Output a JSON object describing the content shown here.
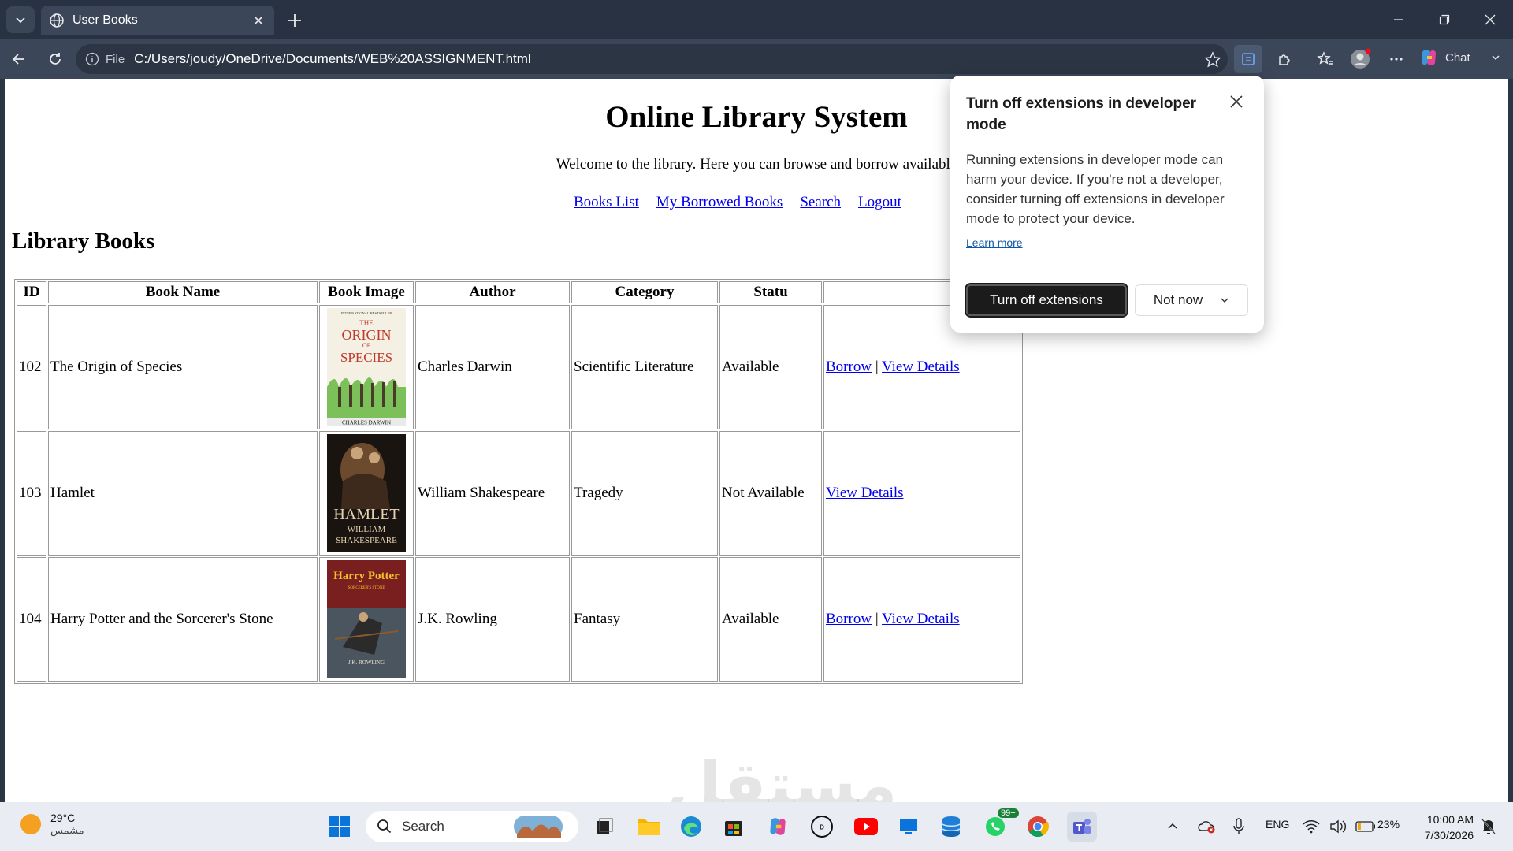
{
  "browser": {
    "tab_title": "User Books",
    "url_prefix": "File",
    "url": "C:/Users/joudy/OneDrive/Documents/WEB%20ASSIGNMENT.html",
    "chat_label": "Chat"
  },
  "page": {
    "heading": "Online Library System",
    "welcome": "Welcome to the library. Here you can browse and borrow available",
    "nav": [
      "Books List",
      "My Borrowed Books",
      "Search",
      "Logout"
    ],
    "section_title": "Library Books",
    "table": {
      "headers": [
        "ID",
        "Book Name",
        "Book Image",
        "Author",
        "Category",
        "Statu"
      ],
      "rows": [
        {
          "id": "102",
          "name": "The Origin of Species",
          "author": "Charles Darwin",
          "category": "Scientific Literature",
          "status": "Available",
          "borrow": "Borrow",
          "sep": "|",
          "details": "View Details",
          "cover": {
            "lines": [
              "THE",
              "ORIGIN",
              "OF",
              "SPECIES"
            ],
            "byline": "CHARLES DARWIN",
            "top": "INTERNATIONAL BESTSELLER"
          }
        },
        {
          "id": "103",
          "name": "Hamlet",
          "author": "William Shakespeare",
          "category": "Tragedy",
          "status": "Not Available",
          "details": "View Details",
          "cover": {
            "title": "HAMLET",
            "byline1": "WILLIAM",
            "byline2": "SHAKESPEARE"
          }
        },
        {
          "id": "104",
          "name": "Harry Potter and the Sorcerer's Stone",
          "author": "J.K. Rowling",
          "category": "Fantasy",
          "status": "Available",
          "borrow": "Borrow",
          "sep": "|",
          "details": "View Details",
          "cover": {
            "title": "Harry Potter",
            "subtitle": "SORCERER'S STONE",
            "byline": "J.K. ROWLING"
          }
        }
      ]
    },
    "watermark": "مستقل"
  },
  "popup": {
    "title": "Turn off extensions in developer mode",
    "body": "Running extensions in developer mode can harm your device. If you're not a developer, consider turning off extensions in developer mode to protect your device.",
    "learn_more": "Learn more",
    "primary": "Turn off extensions",
    "secondary": "Not now"
  },
  "taskbar": {
    "temperature": "29°C",
    "weather_desc": "مشمس",
    "search_placeholder": "Search",
    "whatsapp_badge": "99+",
    "language": "ENG",
    "battery": "23%",
    "time": "10:00 AM",
    "date": "7/30/2026"
  },
  "colors": {
    "link": "#0000ee",
    "chrome_bg": "#283242",
    "taskbar_bg": "#e9edf3"
  }
}
